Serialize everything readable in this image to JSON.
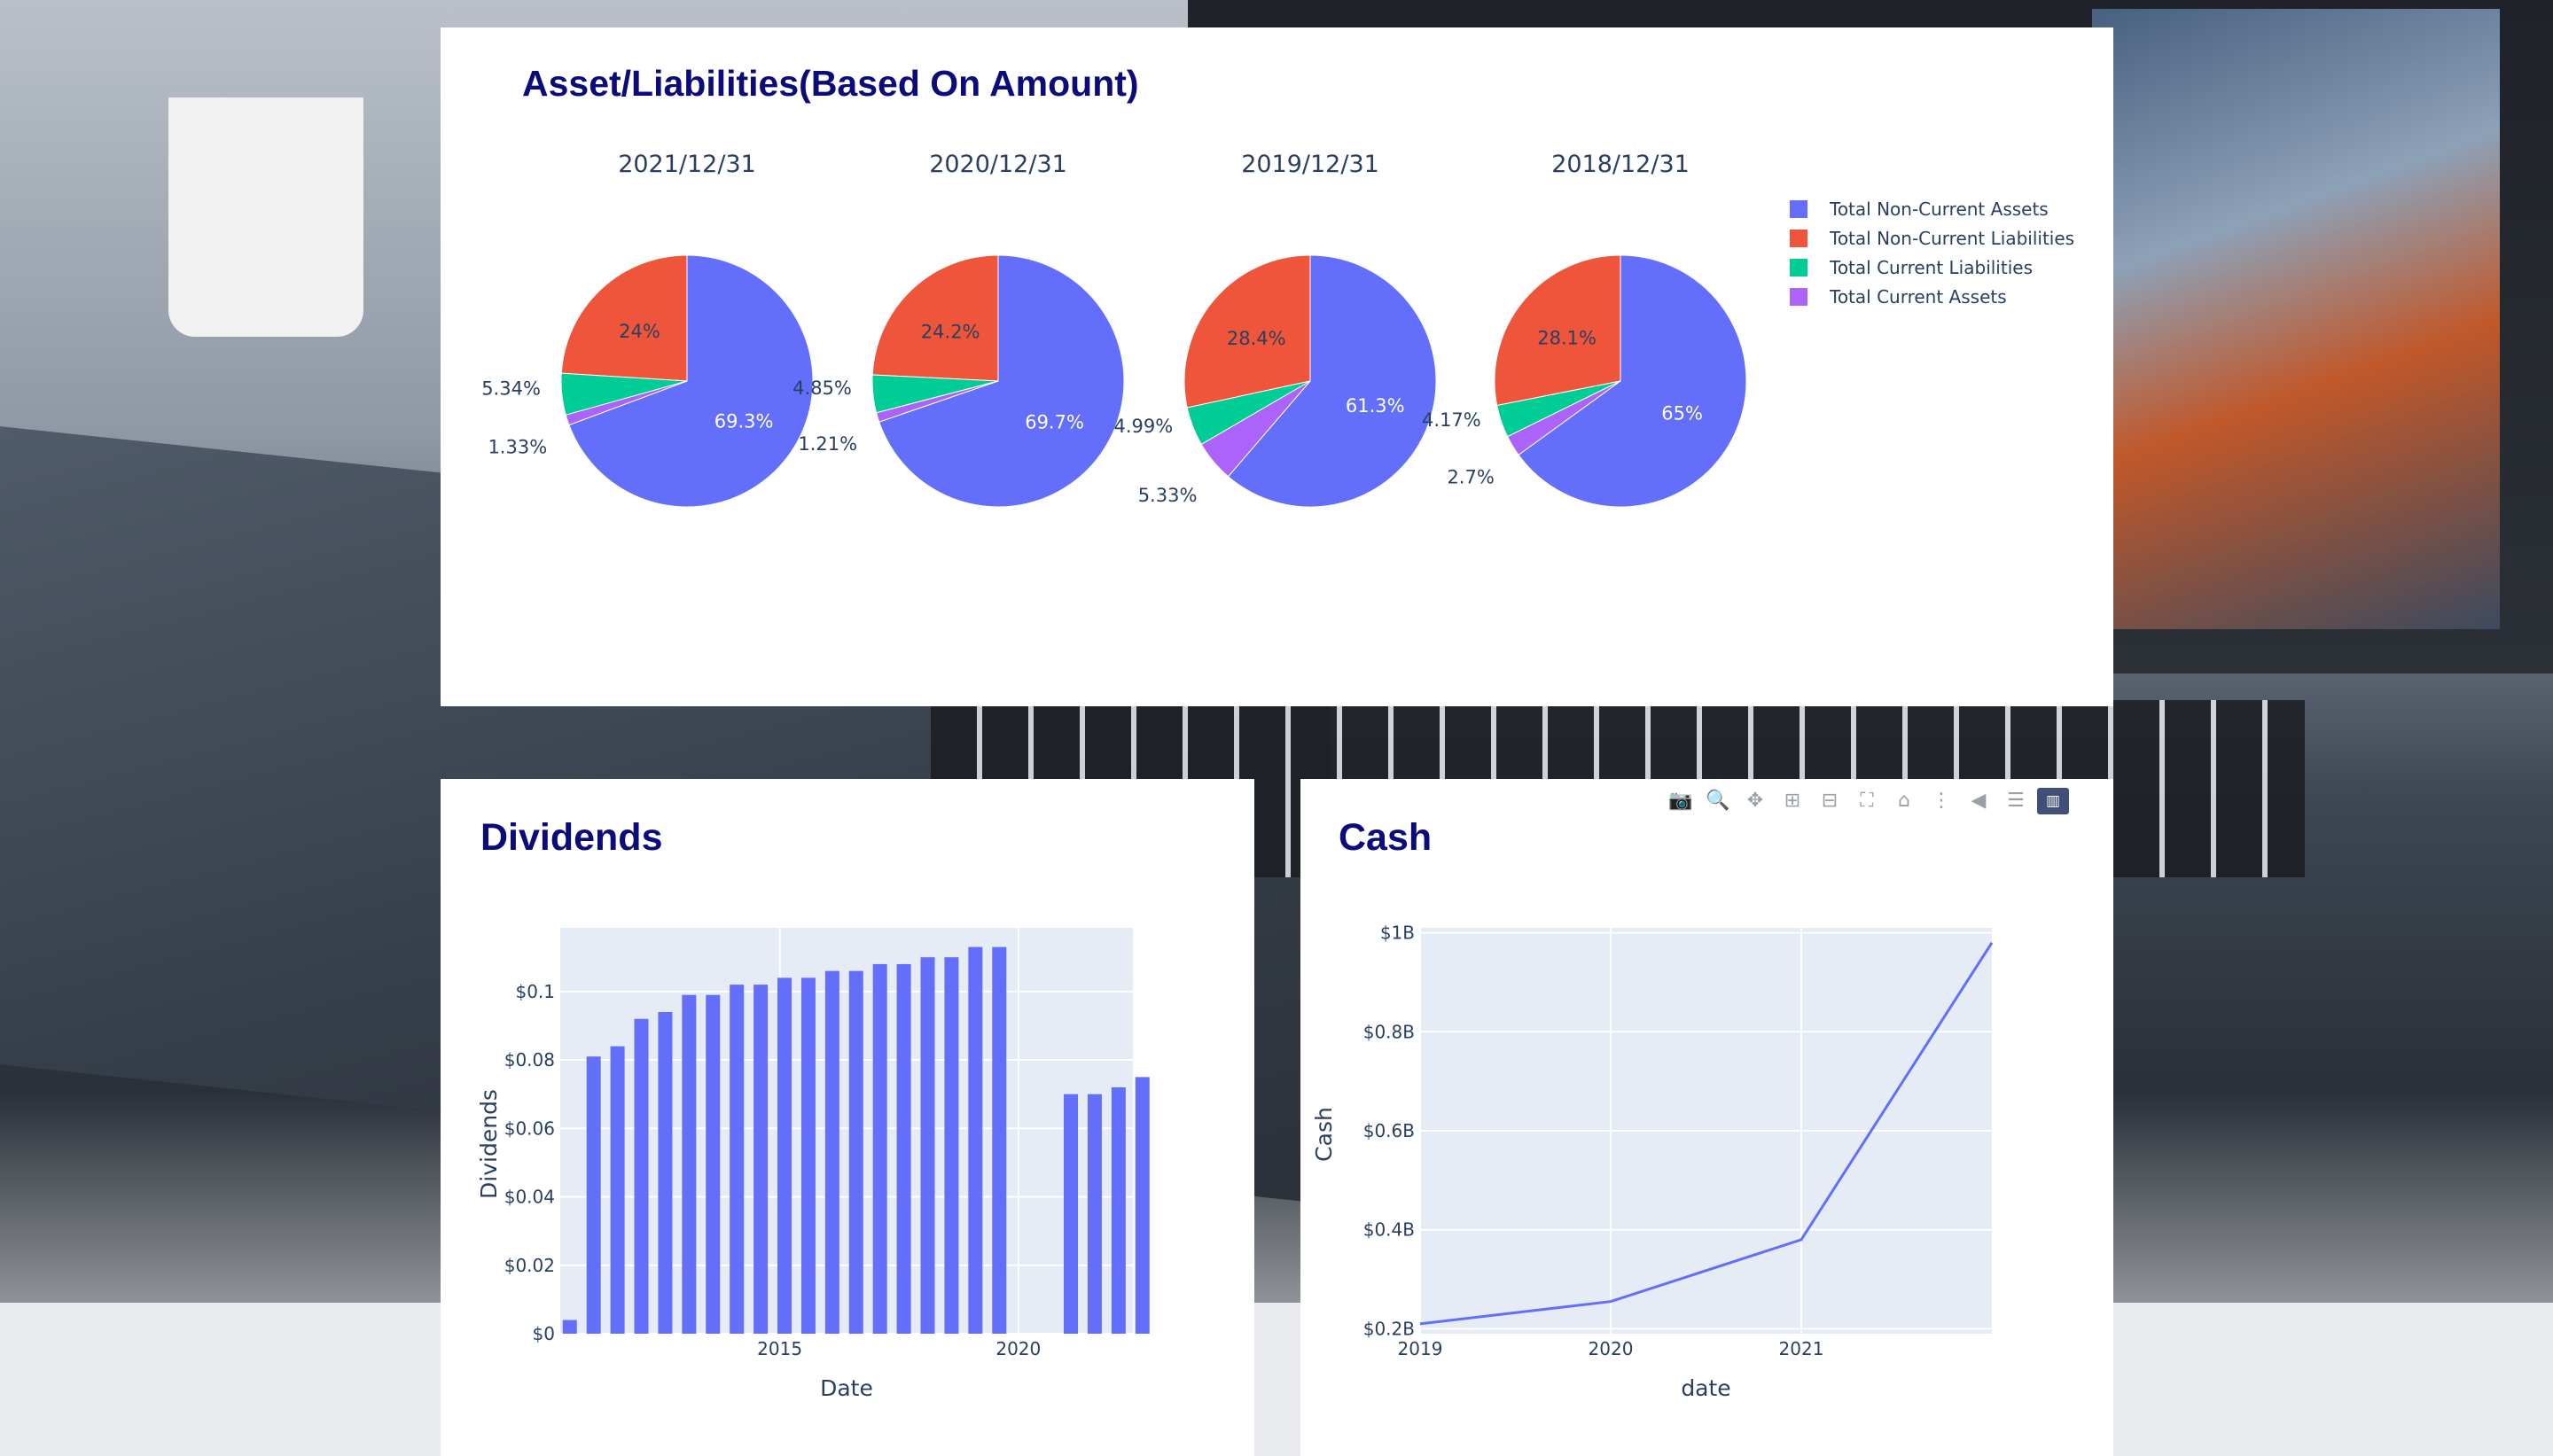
{
  "assets_panel": {
    "title": "Asset/Liabilities(Based On Amount)",
    "chart_data": {
      "type": "pie",
      "title": "Asset/Liabilities(Based On Amount)",
      "categories": [
        "Total Non-Current Assets",
        "Total Non-Current Liabilities",
        "Total Current Liabilities",
        "Total Current Assets"
      ],
      "colors": [
        "#636efa",
        "#ef553b",
        "#00cc96",
        "#ab63fa"
      ],
      "legend": "right",
      "pies": [
        {
          "name": "2021/12/31",
          "values": [
            69.3,
            24,
            5.34,
            1.33
          ],
          "labels": [
            "69.3%",
            "24%",
            "5.34%",
            "1.33%"
          ]
        },
        {
          "name": "2020/12/31",
          "values": [
            69.7,
            24.2,
            4.85,
            1.21
          ],
          "labels": [
            "69.7%",
            "24.2%",
            "4.85%",
            "1.21%"
          ]
        },
        {
          "name": "2019/12/31",
          "values": [
            61.3,
            28.4,
            4.99,
            5.33
          ],
          "labels": [
            "61.3%",
            "28.4%",
            "4.99%",
            "5.33%"
          ]
        },
        {
          "name": "2018/12/31",
          "values": [
            65,
            28.1,
            4.17,
            2.7
          ],
          "labels": [
            "65%",
            "28.1%",
            "4.17%",
            "2.7%"
          ]
        }
      ]
    }
  },
  "dividends_panel": {
    "title": "Dividends",
    "chart_data": {
      "type": "bar",
      "xlabel": "Date",
      "ylabel": "Dividends",
      "color": "#636efa",
      "x": [
        2010.1,
        2011.1,
        2012.1,
        2013.1,
        2014.1,
        2015.1,
        2016.1,
        2017.1,
        2018.1,
        2019.1,
        2020.1,
        2011.1,
        2012.1,
        2013.1,
        2014.1,
        2015.1,
        2016.1,
        2017.1,
        2018.1,
        2019.1,
        2020.1
      ],
      "bars": [
        {
          "x": 2010.6,
          "y": 0.004
        },
        {
          "x": 2011.1,
          "y": 0.081
        },
        {
          "x": 2011.6,
          "y": 0.084
        },
        {
          "x": 2012.1,
          "y": 0.092
        },
        {
          "x": 2012.6,
          "y": 0.094
        },
        {
          "x": 2013.1,
          "y": 0.099
        },
        {
          "x": 2013.6,
          "y": 0.099
        },
        {
          "x": 2014.1,
          "y": 0.102
        },
        {
          "x": 2014.6,
          "y": 0.102
        },
        {
          "x": 2015.1,
          "y": 0.104
        },
        {
          "x": 2015.6,
          "y": 0.104
        },
        {
          "x": 2016.1,
          "y": 0.106
        },
        {
          "x": 2016.6,
          "y": 0.106
        },
        {
          "x": 2017.1,
          "y": 0.108
        },
        {
          "x": 2017.6,
          "y": 0.108
        },
        {
          "x": 2018.1,
          "y": 0.11
        },
        {
          "x": 2018.6,
          "y": 0.11
        },
        {
          "x": 2019.1,
          "y": 0.113
        },
        {
          "x": 2019.6,
          "y": 0.113
        },
        {
          "x": 2021.1,
          "y": 0.07
        },
        {
          "x": 2021.6,
          "y": 0.07
        },
        {
          "x": 2022.1,
          "y": 0.072
        },
        {
          "x": 2022.6,
          "y": 0.075
        }
      ],
      "xlim": [
        2010.4,
        2022.4
      ],
      "ylim": [
        0,
        0.1186
      ],
      "xticks": [
        {
          "v": 2015,
          "label": "2015"
        },
        {
          "v": 2020,
          "label": "2020"
        }
      ],
      "yticks": [
        {
          "v": 0,
          "label": "$0"
        },
        {
          "v": 0.02,
          "label": "$0.02"
        },
        {
          "v": 0.04,
          "label": "$0.04"
        },
        {
          "v": 0.06,
          "label": "$0.06"
        },
        {
          "v": 0.08,
          "label": "$0.08"
        },
        {
          "v": 0.1,
          "label": "$0.1"
        }
      ],
      "grid": true
    }
  },
  "cash_panel": {
    "title": "Cash",
    "toolbar": [
      {
        "name": "camera-icon",
        "glyph": "📷",
        "active": false
      },
      {
        "name": "zoom-icon",
        "glyph": "🔍",
        "active": true
      },
      {
        "name": "pan-icon",
        "glyph": "✥",
        "active": false
      },
      {
        "name": "zoom-in-icon",
        "glyph": "⊞",
        "active": false
      },
      {
        "name": "zoom-out-icon",
        "glyph": "⊟",
        "active": false
      },
      {
        "name": "autoscale-icon",
        "glyph": "⛶",
        "active": false
      },
      {
        "name": "home-icon",
        "glyph": "⌂",
        "active": false
      },
      {
        "name": "spike-lines-icon",
        "glyph": "⋮",
        "active": false
      },
      {
        "name": "hover-closest-icon",
        "glyph": "◀",
        "active": false
      },
      {
        "name": "hover-compare-icon",
        "glyph": "☰",
        "active": false
      },
      {
        "name": "plotly-logo-icon",
        "glyph": "▥",
        "active": false
      }
    ],
    "chart_data": {
      "type": "line",
      "xlabel": "date",
      "ylabel": "Cash",
      "color": "#636efa",
      "x": [
        2019,
        2020,
        2021,
        2022
      ],
      "y": [
        0.21,
        0.255,
        0.38,
        0.98
      ],
      "xlim": [
        2019,
        2022
      ],
      "ylim": [
        0.19,
        1.01
      ],
      "xticks": [
        {
          "v": 2019,
          "label": "2019"
        },
        {
          "v": 2020,
          "label": "2020"
        },
        {
          "v": 2021,
          "label": "2021"
        }
      ],
      "yticks": [
        {
          "v": 0.2,
          "label": "$0.2B"
        },
        {
          "v": 0.4,
          "label": "$0.4B"
        },
        {
          "v": 0.6,
          "label": "$0.6B"
        },
        {
          "v": 0.8,
          "label": "$0.8B"
        },
        {
          "v": 1.0,
          "label": "$1B"
        }
      ],
      "grid": true
    }
  }
}
